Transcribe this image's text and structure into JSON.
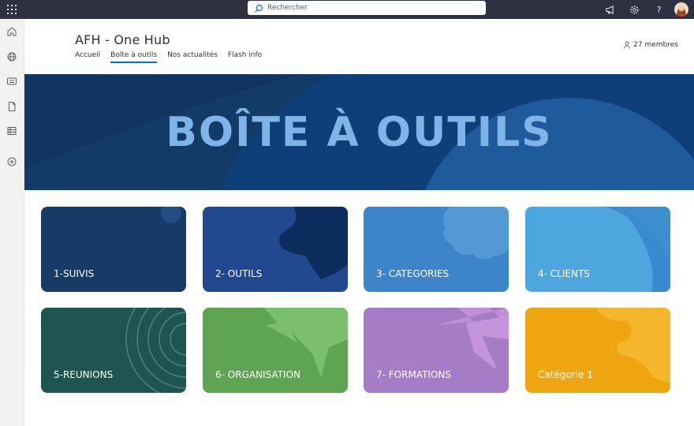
{
  "topbar": {
    "search_placeholder": "Rechercher",
    "icons": [
      "app-launcher-icon",
      "search-icon",
      "megaphone-icon",
      "gear-icon",
      "help-icon",
      "avatar"
    ],
    "help_glyph": "?"
  },
  "rail": {
    "icons": [
      "home-icon",
      "globe-icon",
      "news-icon",
      "file-icon",
      "list-icon",
      "add-icon"
    ]
  },
  "site": {
    "title": "AFH - One Hub",
    "members": "27 membres",
    "nav": [
      {
        "label": "Accueil",
        "active": false
      },
      {
        "label": "Boîte à outils",
        "active": true
      },
      {
        "label": "Nos actualités",
        "active": false
      },
      {
        "label": "Flash info",
        "active": false
      }
    ]
  },
  "banner": {
    "title": "BOÎTE À OUTILS",
    "color": "#0f3f78",
    "text_color": "#7fb4e8"
  },
  "tiles": [
    {
      "label": "1-SUIVIS",
      "color": "#173a66"
    },
    {
      "label": "2- OUTILS",
      "color": "#22498f"
    },
    {
      "label": "3- CATEGORIES",
      "color": "#3d84ca"
    },
    {
      "label": "4- CLIENTS",
      "color": "#4ea6de"
    },
    {
      "label": "5-REUNIONS",
      "color": "#1f5550"
    },
    {
      "label": "6- ORGANISATION",
      "color": "#5ea452"
    },
    {
      "label": "7- FORMATIONS",
      "color": "#a77cc6"
    },
    {
      "label": "Catégorie 1",
      "color": "#eea510"
    }
  ]
}
